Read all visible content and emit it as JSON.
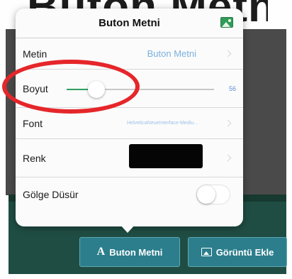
{
  "background": {
    "title": "Buton Metni"
  },
  "popover": {
    "title": "Buton Metni",
    "header_icon": "picture-icon",
    "rows": {
      "text": {
        "label": "Metin",
        "value": "Buton Metni"
      },
      "size": {
        "label": "Boyut",
        "value": "56",
        "level": 0.2
      },
      "font": {
        "label": "Font",
        "value": "HelveticaNeueInterface-Mediu..."
      },
      "color": {
        "label": "Renk",
        "swatch": "#050505"
      },
      "shadow": {
        "label": "Gölge Düsür",
        "enabled": false
      }
    }
  },
  "toolbar": {
    "text_button": {
      "icon_glyph": "A",
      "label": "Buton Metni"
    },
    "image_button": {
      "icon": "image-icon",
      "label": "Görüntü Ekle"
    }
  },
  "colors": {
    "accent_green": "#2fa060",
    "toolbar_bg": "#1f4d43",
    "button_bg": "#2c7e8c",
    "annotation": "#e5262a"
  }
}
